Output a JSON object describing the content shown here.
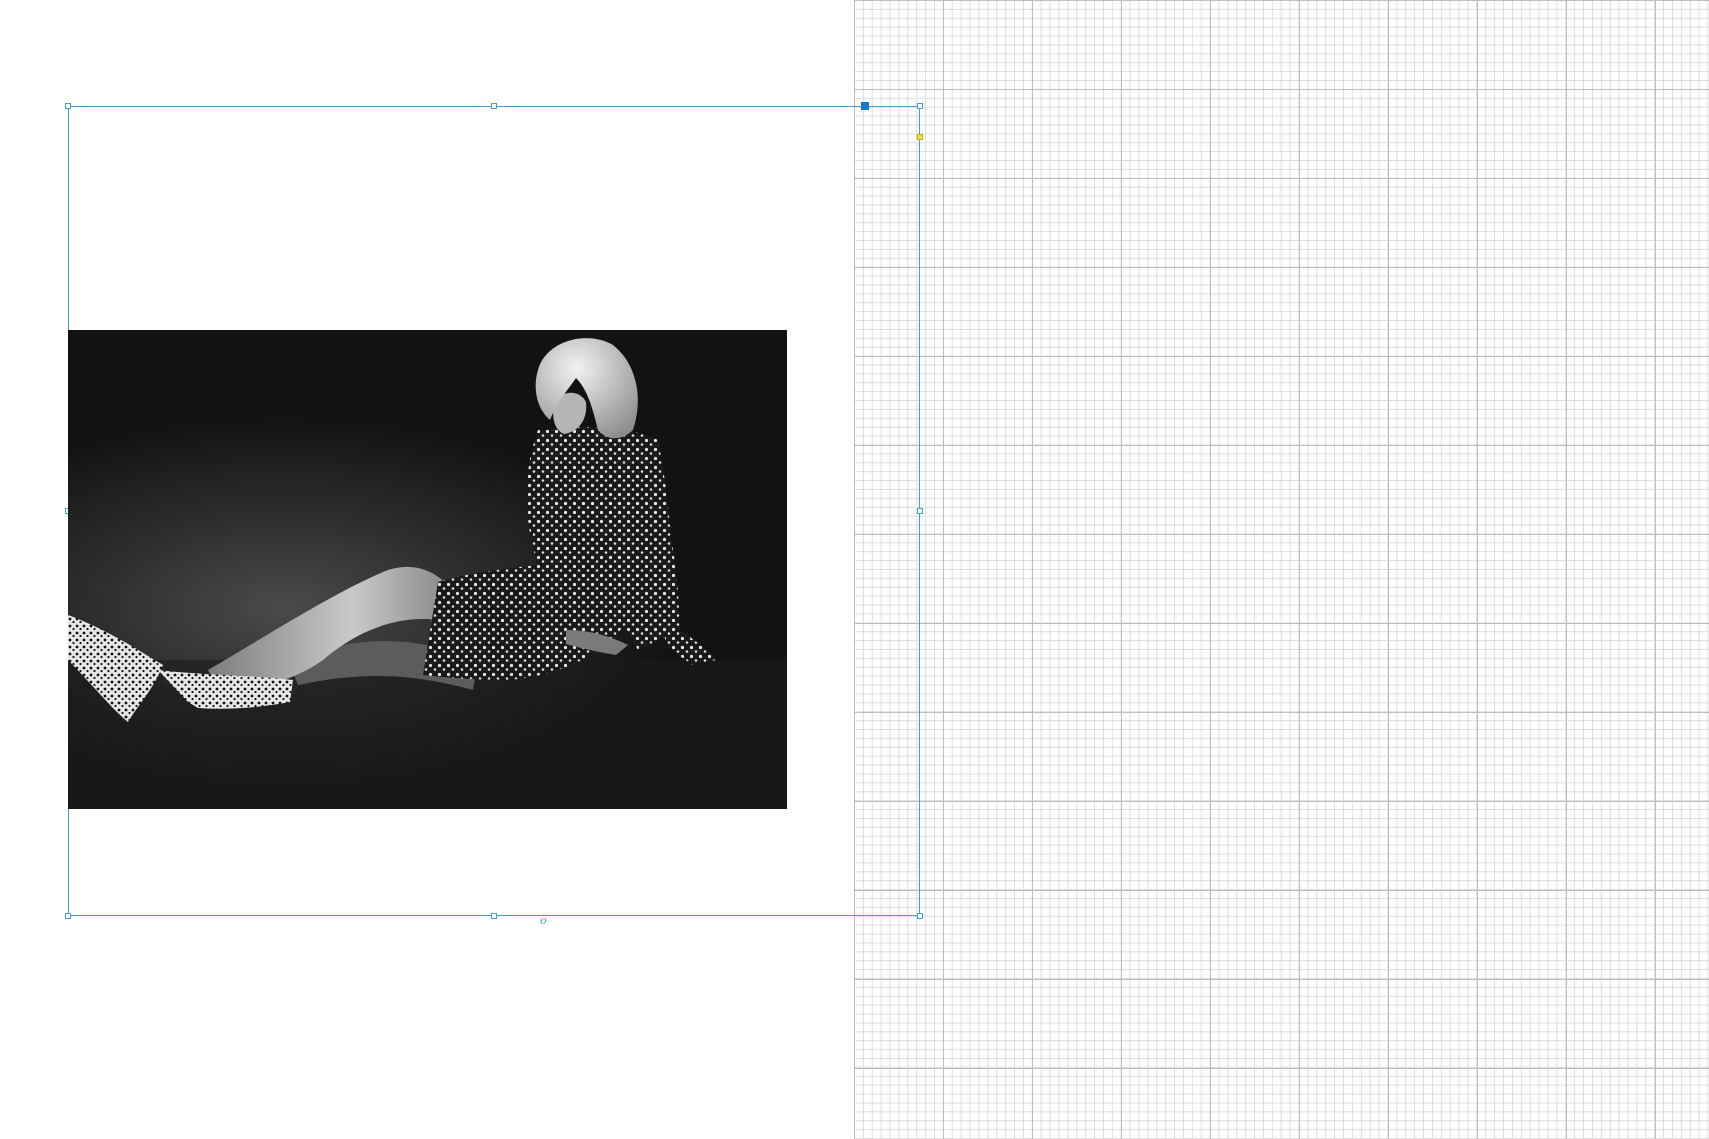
{
  "canvas": {
    "pasteboard_grid": "visible",
    "selection_color": "#3fa0d6",
    "accent_handle_color": "#1976d2",
    "anchor_color": "#f5e23a"
  },
  "selected_frame": {
    "type": "graphics-frame",
    "state": "selected",
    "image": {
      "name": "fashion-photo",
      "style": "black-and-white",
      "subject": "seated-woman-in-patterned-dress"
    }
  },
  "frame_marker": "o"
}
